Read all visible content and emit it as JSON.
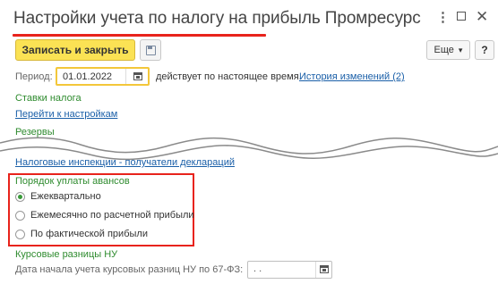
{
  "window": {
    "title": "Настройки учета по налогу на прибыль Промресурс",
    "more_glyph": "⋮",
    "close_glyph": "✕"
  },
  "toolbar": {
    "save_close_label": "Записать и закрыть",
    "more_label": "Еще",
    "more_arrow": "▾",
    "help_label": "?"
  },
  "period": {
    "label": "Период:",
    "value": "01.01.2022",
    "note": "действует по настоящее время.",
    "history_link": "История изменений (2)"
  },
  "tax_rates": {
    "heading": "Ставки налога",
    "settings_link": "Перейти к настройкам"
  },
  "reserves": {
    "heading": "Резервы"
  },
  "inspections_link": "Налоговые инспекции - получатели деклараций",
  "advance_payment": {
    "heading": "Порядок уплаты авансов",
    "options": [
      {
        "label": "Ежеквартально",
        "selected": true
      },
      {
        "label": "Ежемесячно по расчетной прибыли",
        "selected": false
      },
      {
        "label": "По фактической прибыли",
        "selected": false
      }
    ]
  },
  "exchange_diff": {
    "heading": "Курсовые разницы НУ",
    "date_label": "Дата начала учета курсовых разниц НУ по 67-ФЗ:",
    "date_value": "  .  .",
    "date_placeholder": ""
  },
  "colors": {
    "accent_yellow": "#fbe254",
    "highlight_red": "#e8231c",
    "section_green": "#2e8b2e",
    "link_blue": "#1a5fa8"
  },
  "icons": {
    "save": "floppy-disk-icon",
    "calendar": "calendar-icon"
  }
}
